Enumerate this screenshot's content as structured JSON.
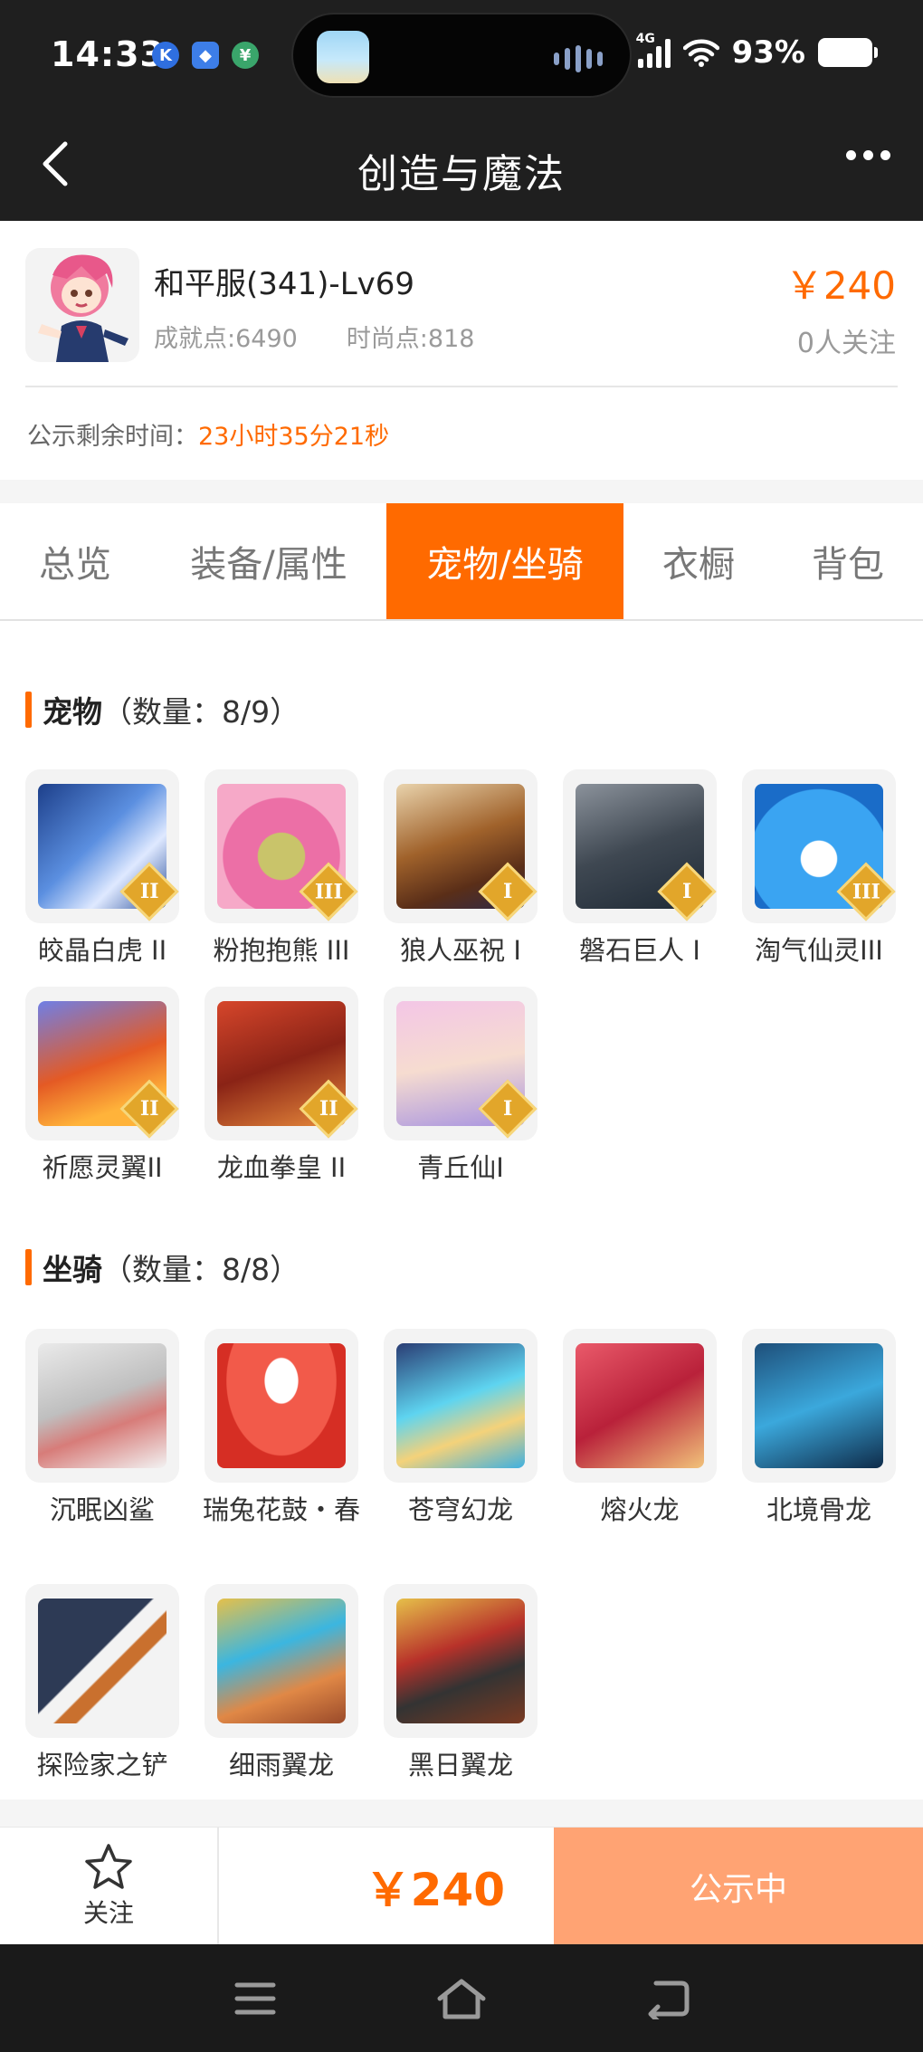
{
  "status_bar": {
    "time": "14:33",
    "network": "4G",
    "battery": "93%"
  },
  "header": {
    "title": "创造与魔法"
  },
  "character": {
    "name": "和平服(341)-Lv69",
    "achievement": "成就点:6490",
    "fashion": "时尚点:818",
    "price": "￥240",
    "followers": "0人关注",
    "public_label": "公示剩余时间：",
    "public_time": "23小时35分21秒"
  },
  "tabs": [
    {
      "label": "总览"
    },
    {
      "label": "装备/属性"
    },
    {
      "label": "宠物/坐骑",
      "active": true
    },
    {
      "label": "衣橱"
    },
    {
      "label": "背包"
    }
  ],
  "pets": {
    "title": "宠物",
    "count": "（数量：8/9）",
    "items": [
      {
        "label": "皎晶白虎 II",
        "badge": "II",
        "icon": "white-tiger-icon"
      },
      {
        "label": "粉抱抱熊 III",
        "badge": "III",
        "icon": "pink-bear-icon"
      },
      {
        "label": "狼人巫祝 I",
        "badge": "I",
        "icon": "werewolf-icon"
      },
      {
        "label": "磐石巨人 I",
        "badge": "I",
        "icon": "rock-giant-icon"
      },
      {
        "label": "淘气仙灵III",
        "badge": "III",
        "icon": "blue-puppy-icon"
      },
      {
        "label": "祈愿灵翼II",
        "badge": "II",
        "icon": "wing-bird-icon"
      },
      {
        "label": "龙血拳皇 II",
        "badge": "II",
        "icon": "dragon-fighter-icon"
      },
      {
        "label": "青丘仙I",
        "badge": "I",
        "icon": "fox-fairy-icon"
      }
    ]
  },
  "mounts": {
    "title": "坐骑",
    "count": "（数量：8/8）",
    "items": [
      {
        "label": "沉眠凶鲨",
        "icon": "shark-icon"
      },
      {
        "label": "瑞兔花鼓・春",
        "icon": "rabbit-drum-icon"
      },
      {
        "label": "苍穹幻龙",
        "icon": "sky-dragon-icon"
      },
      {
        "label": "熔火龙",
        "icon": "fire-dragon-icon"
      },
      {
        "label": "北境骨龙",
        "icon": "bone-dragon-icon"
      },
      {
        "label": "探险家之铲",
        "icon": "shovel-icon"
      },
      {
        "label": "细雨翼龙",
        "icon": "rain-pterosaur-icon"
      },
      {
        "label": "黑日翼龙",
        "icon": "black-sun-pterosaur-icon"
      }
    ]
  },
  "action_bar": {
    "follow_label": "关注",
    "price": "￥240",
    "status_label": "公示中"
  },
  "colors": {
    "accent": "#ff6a00",
    "status_button": "#ffa373",
    "dark_bar": "#1f1f1f"
  }
}
